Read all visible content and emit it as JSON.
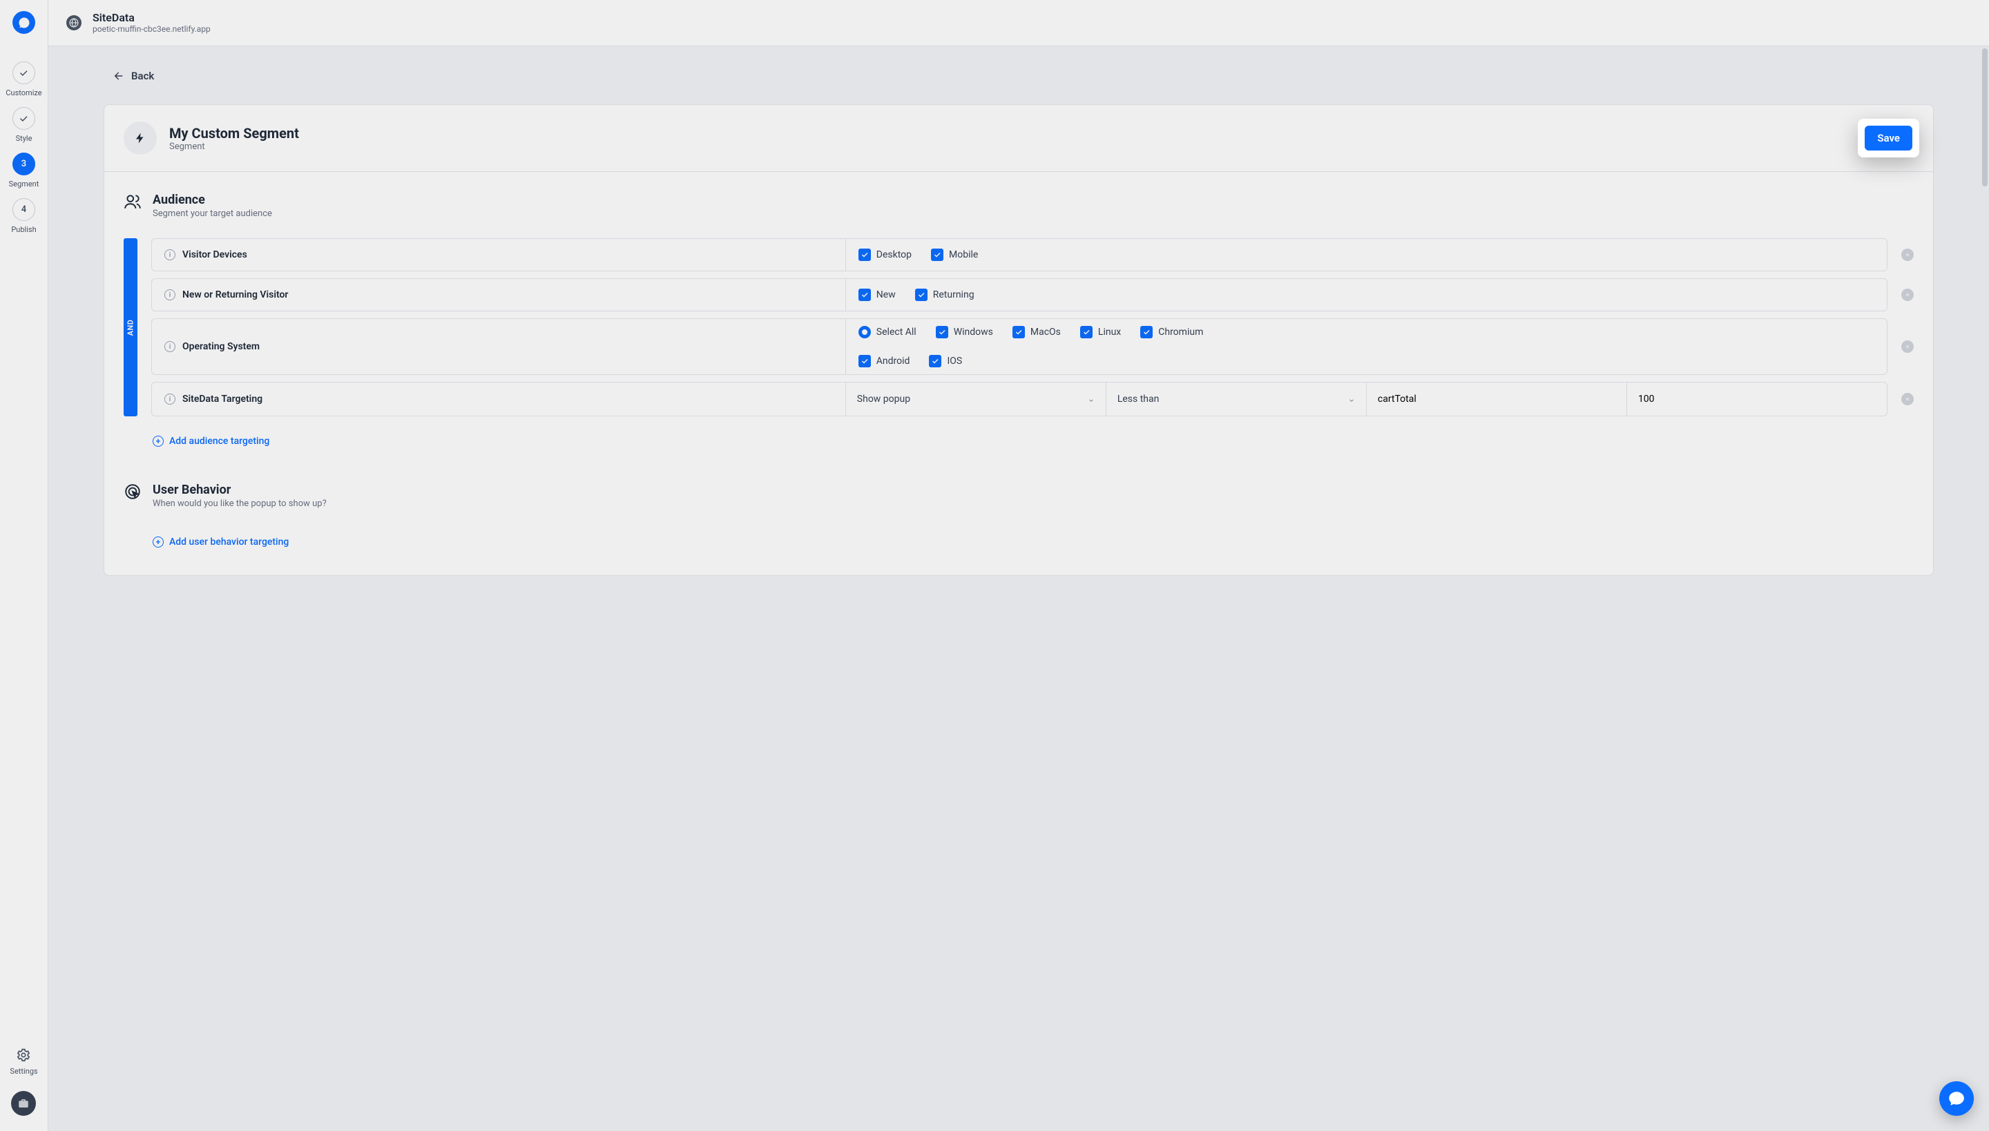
{
  "site": {
    "name": "SiteData",
    "url": "poetic-muffin-cbc3ee.netlify.app"
  },
  "nav": {
    "steps": [
      {
        "label": "Customize",
        "done": true
      },
      {
        "label": "Style",
        "done": true
      },
      {
        "num": "3",
        "label": "Segment",
        "active": true
      },
      {
        "num": "4",
        "label": "Publish"
      }
    ],
    "settings": "Settings"
  },
  "back": "Back",
  "header": {
    "title": "My Custom Segment",
    "subtitle": "Segment",
    "save": "Save"
  },
  "audience": {
    "title": "Audience",
    "subtitle": "Segment your target audience",
    "joiner": "AND",
    "rules": {
      "devices": {
        "label": "Visitor Devices",
        "opts": [
          "Desktop",
          "Mobile"
        ]
      },
      "visitor": {
        "label": "New or Returning Visitor",
        "opts": [
          "New",
          "Returning"
        ]
      },
      "os": {
        "label": "Operating System",
        "select_all": "Select All",
        "row1": [
          "Windows",
          "MacOs",
          "Linux",
          "Chromium"
        ],
        "row2": [
          "Android",
          "IOS"
        ]
      },
      "targeting": {
        "label": "SiteData Targeting",
        "action": "Show popup",
        "comparator": "Less than",
        "key": "cartTotal",
        "value": "100"
      }
    },
    "add": "Add audience targeting"
  },
  "behavior": {
    "title": "User Behavior",
    "subtitle": "When would you like the popup to show up?",
    "add": "Add user behavior targeting"
  }
}
